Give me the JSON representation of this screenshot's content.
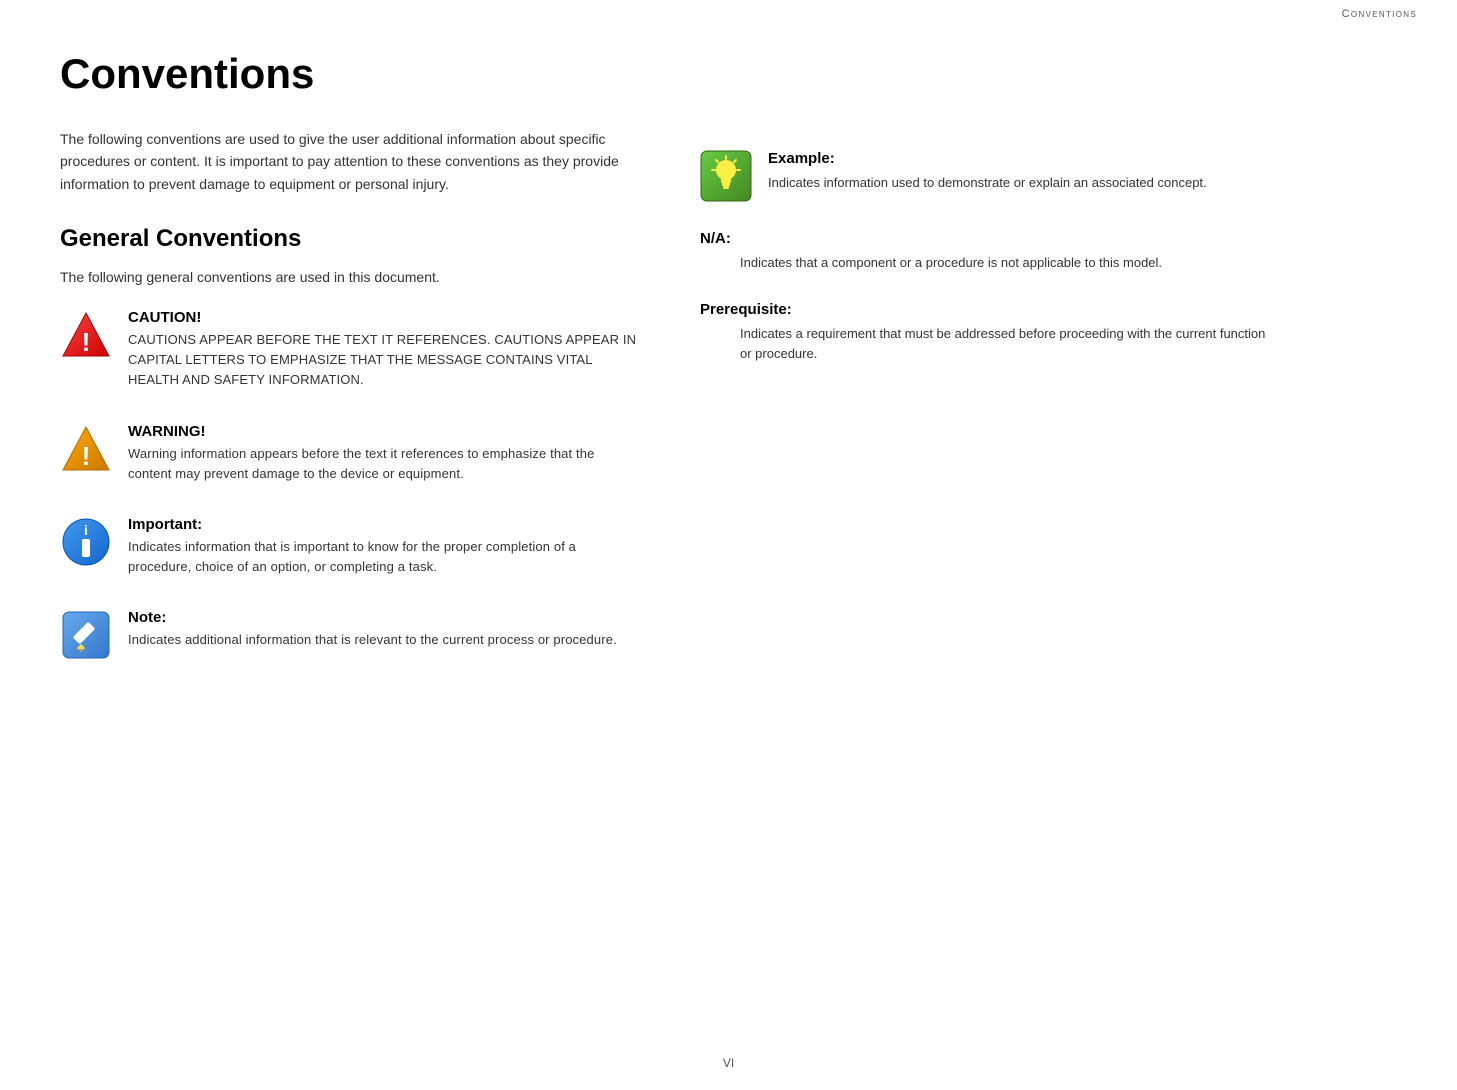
{
  "header": {
    "title": "Conventions"
  },
  "page": {
    "header_label": "Conventions",
    "title": "Conventions",
    "intro": "The following conventions are used to give the user additional information about specific procedures or content. It is important to pay attention to these conventions as they provide information to prevent damage to equipment or personal injury.",
    "general_title": "General Conventions",
    "general_intro": "The following general conventions are used in this document.",
    "footer": "VI"
  },
  "left_items": [
    {
      "id": "caution",
      "label": "CAUTION!",
      "desc": "CAUTIONS APPEAR BEFORE THE TEXT IT REFERENCES. CAUTIONS APPEAR IN CAPITAL LETTERS TO EMPHASIZE THAT THE MESSAGE CONTAINS VITAL HEALTH AND SAFETY INFORMATION.",
      "uppercase": true,
      "icon_type": "caution"
    },
    {
      "id": "warning",
      "label": "WARNING!",
      "desc": "Warning information appears before the text it references to emphasize that the content may prevent damage to the device or equipment.",
      "uppercase": false,
      "icon_type": "warning"
    },
    {
      "id": "important",
      "label": "Important:",
      "desc": "Indicates information that is important to know for the proper completion of a procedure, choice of an option, or completing a task.",
      "uppercase": false,
      "icon_type": "important"
    },
    {
      "id": "note",
      "label": "Note:",
      "desc": "Indicates additional information that is relevant to the current process or procedure.",
      "uppercase": false,
      "icon_type": "note"
    }
  ],
  "right_items": [
    {
      "id": "example",
      "label": "Example:",
      "desc": "Indicates information used to demonstrate or explain an associated concept.",
      "has_icon": true,
      "icon_type": "example"
    },
    {
      "id": "na",
      "label": "N/A:",
      "desc": "Indicates that a component or a procedure is not applicable to this model.",
      "has_icon": false
    },
    {
      "id": "prerequisite",
      "label": "Prerequisite:",
      "desc": "Indicates a requirement that must be addressed before proceeding with the current function or procedure.",
      "has_icon": false
    }
  ]
}
